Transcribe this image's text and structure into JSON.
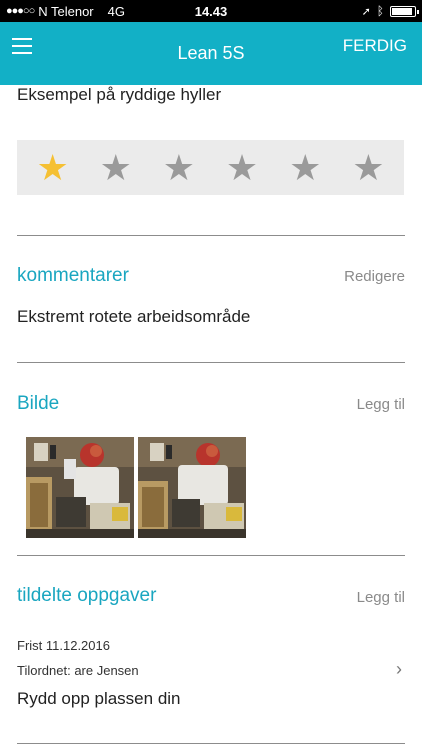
{
  "status_bar": {
    "carrier": "N Telenor",
    "network": "4G",
    "time": "14.43",
    "battery_level": 0.9
  },
  "navbar": {
    "title": "Lean 5S",
    "done_label": "FERDIG",
    "menu_icon": "hamburger-menu-icon"
  },
  "example": {
    "text": "Eksempel på ryddige hyller"
  },
  "rating": {
    "value": 1,
    "max": 6,
    "filled_color": "#f5c033",
    "empty_color": "#9a9a9a"
  },
  "comments": {
    "title": "kommentarer",
    "action": "Redigere",
    "text": "Ekstremt rotete arbeidsområde"
  },
  "images": {
    "title": "Bilde",
    "action": "Legg til",
    "count": 2
  },
  "tasks": {
    "title": "tildelte oppgaver",
    "action": "Legg til",
    "items": [
      {
        "deadline": "Frist 11.12.2016",
        "assignee": "Tilordnet: are Jensen",
        "title": "Rydd opp plassen din"
      }
    ]
  },
  "colors": {
    "accent": "#12b0c6",
    "section_title": "#1aa6c0"
  }
}
